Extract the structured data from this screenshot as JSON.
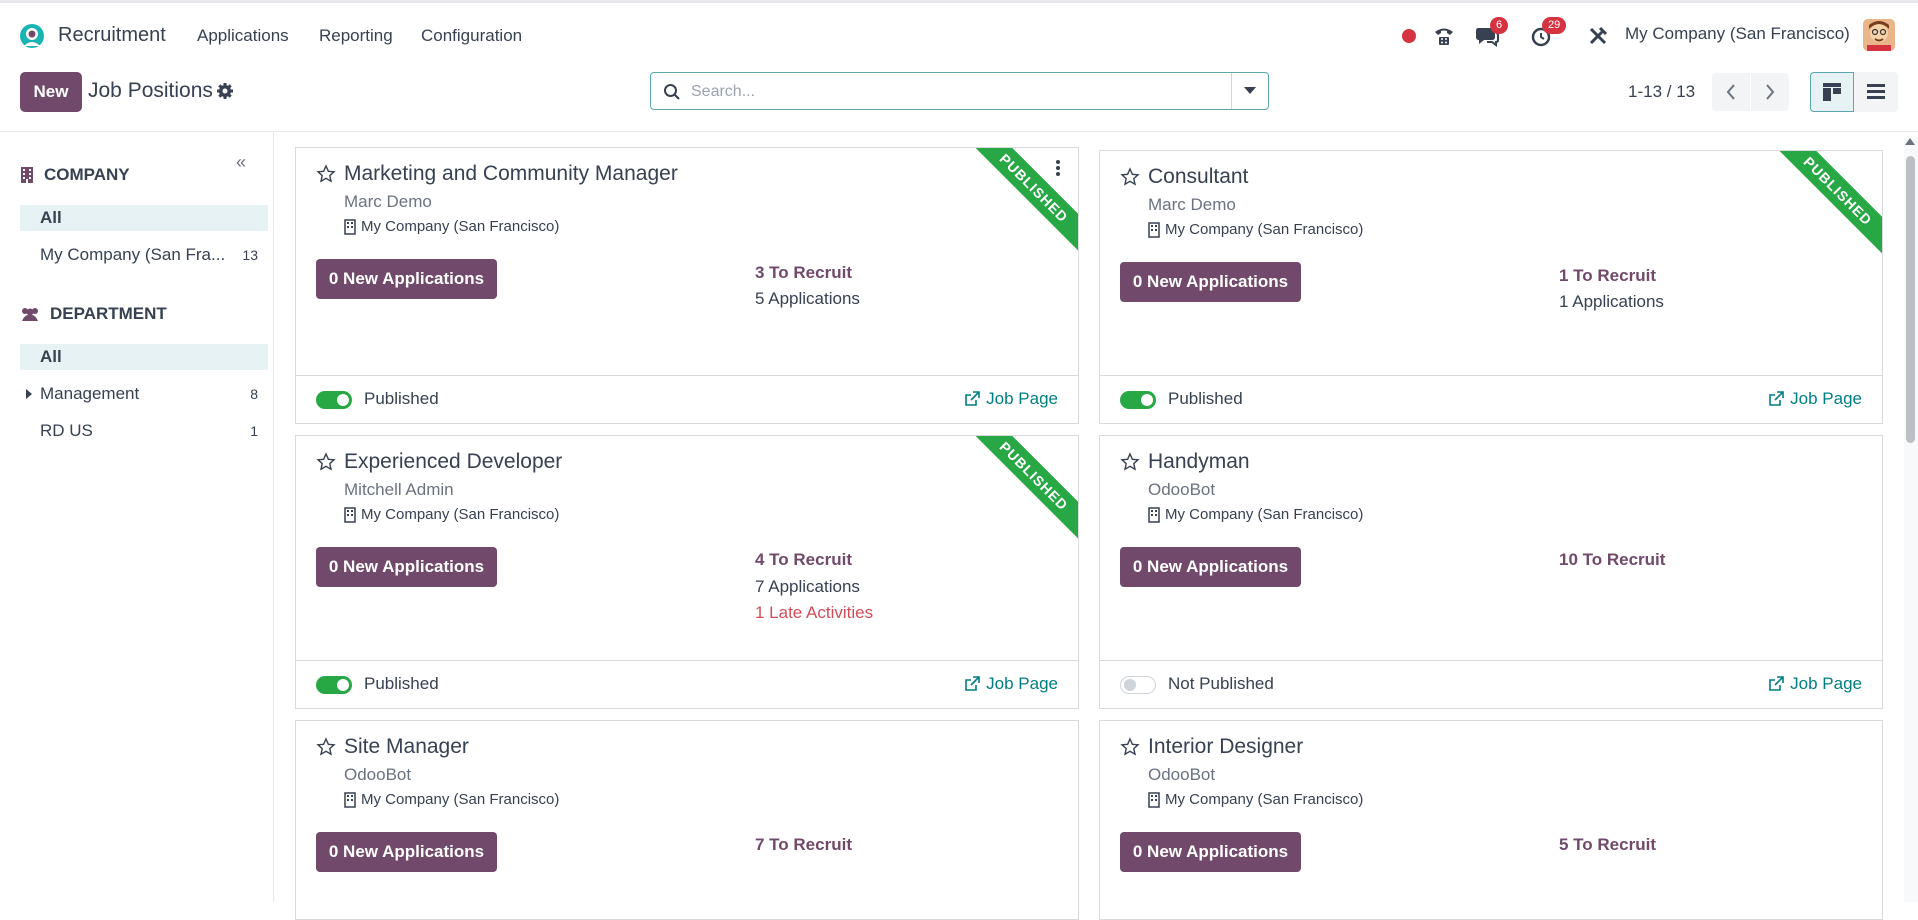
{
  "app": {
    "name": "Recruitment"
  },
  "menu": [
    "Applications",
    "Reporting",
    "Configuration"
  ],
  "systray": {
    "chat_badge": "6",
    "activity_badge": "29",
    "company": "My Company (San Francisco)"
  },
  "control": {
    "new_label": "New",
    "title": "Job Positions",
    "search_placeholder": "Search...",
    "pager": "1-13 / 13"
  },
  "sidebar": {
    "company_header": "COMPANY",
    "company_items": [
      {
        "label": "All",
        "count": ""
      },
      {
        "label": "My Company (San Fra...",
        "count": "13"
      }
    ],
    "department_header": "DEPARTMENT",
    "department_items": [
      {
        "label": "All",
        "count": ""
      },
      {
        "label": "Management",
        "count": "8"
      },
      {
        "label": "RD US",
        "count": "1"
      }
    ]
  },
  "ribbon_label": "PUBLISHED",
  "job_page_label": "Job Page",
  "jobs": [
    {
      "title": "Marketing and Community Manager",
      "user": "Marc Demo",
      "company": "My Company (San Francisco)",
      "new_apps": "0 New Applications",
      "to_recruit": "3 To Recruit",
      "applications": "5 Applications",
      "late": "",
      "status": "Published",
      "published": true
    },
    {
      "title": "Consultant",
      "user": "Marc Demo",
      "company": "My Company (San Francisco)",
      "new_apps": "0 New Applications",
      "to_recruit": "1 To Recruit",
      "applications": "1 Applications",
      "late": "",
      "status": "Published",
      "published": true
    },
    {
      "title": "Experienced Developer",
      "user": "Mitchell Admin",
      "company": "My Company (San Francisco)",
      "new_apps": "0 New Applications",
      "to_recruit": "4 To Recruit",
      "applications": "7 Applications",
      "late": "1 Late Activities",
      "status": "Published",
      "published": true
    },
    {
      "title": "Handyman",
      "user": "OdooBot",
      "company": "My Company (San Francisco)",
      "new_apps": "0 New Applications",
      "to_recruit": "10 To Recruit",
      "applications": "",
      "late": "",
      "status": "Not Published",
      "published": false
    },
    {
      "title": "Site Manager",
      "user": "OdooBot",
      "company": "My Company (San Francisco)",
      "new_apps": "0 New Applications",
      "to_recruit": "7 To Recruit",
      "applications": "",
      "late": "",
      "status": "",
      "published": false
    },
    {
      "title": "Interior Designer",
      "user": "OdooBot",
      "company": "My Company (San Francisco)",
      "new_apps": "0 New Applications",
      "to_recruit": "5 To Recruit",
      "applications": "",
      "late": "",
      "status": "",
      "published": false
    }
  ],
  "colors": {
    "brand": "#71496a",
    "teal": "#017e84",
    "green": "#28a745",
    "danger": "#d44c59"
  }
}
